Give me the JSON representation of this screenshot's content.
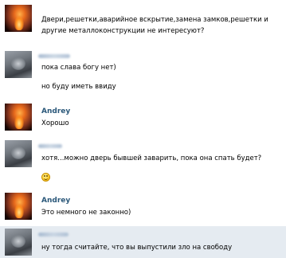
{
  "messages": [
    {
      "author": "",
      "text": "Двери,решетки,аварийное вскрытие,замена замков,решетки и другие металлоконструкции не интересуют?"
    },
    {
      "author": "",
      "text": "пока слава богу нет)",
      "text2": "но буду иметь ввиду"
    },
    {
      "author": "Andrey",
      "text": "Хорошо"
    },
    {
      "author": "",
      "text": "хотя...можно дверь бывшей заварить, пока она спать будет?",
      "emoji": "smile-emoji-icon"
    },
    {
      "author": "Andrey",
      "text": "Это немного не законно)"
    },
    {
      "author": "",
      "text": "ну тогда считайте, что вы выпустили зло на свободу"
    }
  ],
  "colors": {
    "name": "#2b587a",
    "highlight": "#e5ebf1"
  }
}
